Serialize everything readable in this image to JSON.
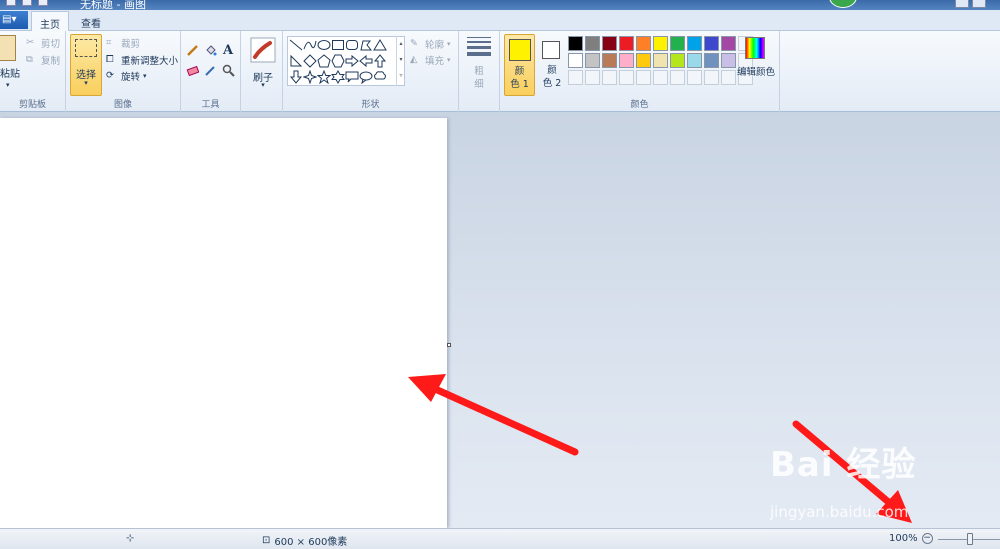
{
  "window": {
    "title": "无标题 - 画图"
  },
  "tabs": {
    "file": "▤▾",
    "home": "主页",
    "view": "查看"
  },
  "clipboard": {
    "paste": "粘贴",
    "cut": "剪切",
    "copy": "复制",
    "group": "剪贴板"
  },
  "image": {
    "select": "选择",
    "crop": "裁剪",
    "resize": "重新调整大小",
    "rotate": "旋转",
    "group": "图像"
  },
  "tools": {
    "group": "工具",
    "brushes": "刷子"
  },
  "shapes": {
    "outline": "轮廓",
    "fill": "填充",
    "group": "形状"
  },
  "size": {
    "label_line1": "粗",
    "label_line2": "细"
  },
  "colors": {
    "color1_line1": "颜",
    "color1_line2": "色 1",
    "color2_line1": "颜",
    "color2_line2": "色 2",
    "edit": "编辑颜色",
    "group": "颜色",
    "active_color1": "#fff200",
    "palette": [
      "#000000",
      "#7f7f7f",
      "#880015",
      "#ed1c24",
      "#ff7f27",
      "#fff200",
      "#22b14c",
      "#00a2e8",
      "#3f48cc",
      "#a349a4",
      "#ffffff",
      "#c3c3c3",
      "#b97a57",
      "#ffaec9",
      "#ffc90e",
      "#efe4b0",
      "#b5e61d",
      "#99d9ea",
      "#7092be",
      "#c8bfe7"
    ]
  },
  "status": {
    "size": "600 × 600像素",
    "zoom": "100%"
  },
  "watermark": {
    "brand": "Bai 经验",
    "url": "jingyan.baidu.com"
  }
}
